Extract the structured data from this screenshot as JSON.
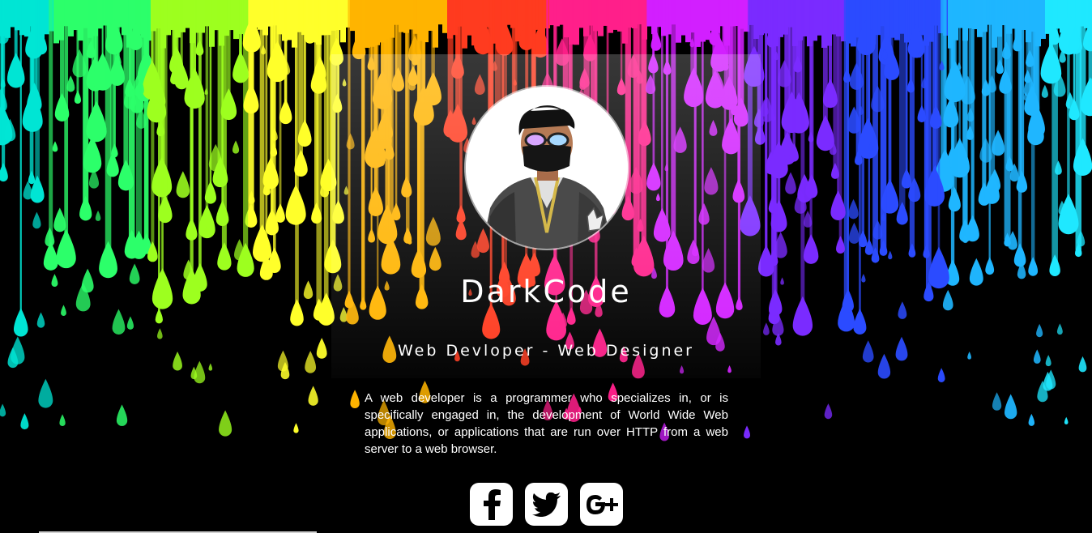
{
  "profile": {
    "name": "DarkCode",
    "role": "Web Devloper - Web Designer",
    "description": "A web developer is a programmer who specializes in, or is specifically engaged in, the development of World Wide Web applications, or applications that are run over HTTP from a web server to a web browser."
  },
  "social": [
    {
      "label": "Facebook",
      "icon": "facebook-icon"
    },
    {
      "label": "Twitter",
      "icon": "twitter-icon"
    },
    {
      "label": "Google Plus",
      "icon": "google-plus-icon"
    }
  ],
  "colors": {
    "background": "#000000",
    "text": "#ffffff",
    "icon_bg": "#ffffff",
    "icon_fg": "#000000",
    "drip_palette": [
      "#00e5d4",
      "#2cff6a",
      "#9dff1f",
      "#ffff2a",
      "#ffb400",
      "#ff3b1f",
      "#ff1f8a",
      "#d21fff",
      "#7a2bff",
      "#2b4bff",
      "#1fb6ff",
      "#1fe8ff"
    ]
  }
}
